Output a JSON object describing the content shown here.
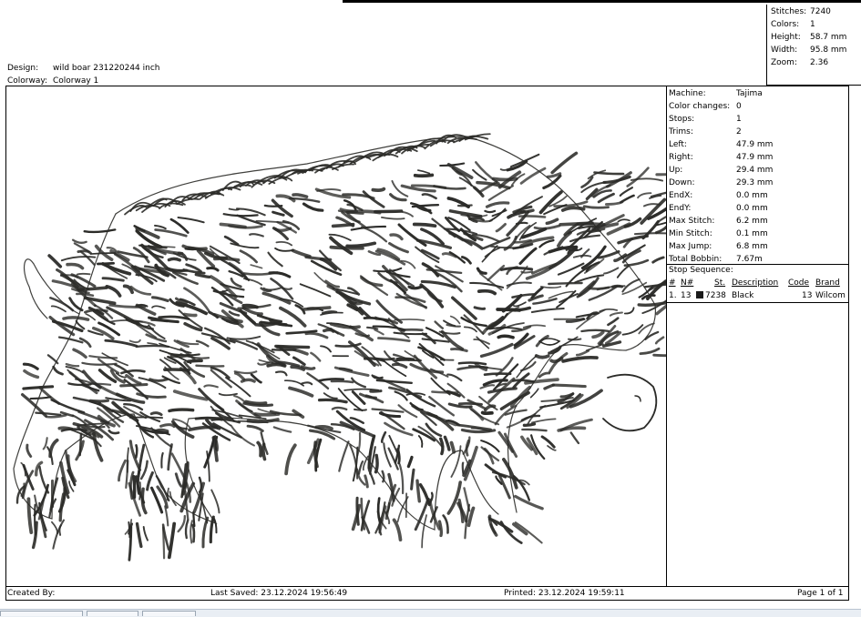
{
  "stats": {
    "stitches_label": "Stitches:",
    "stitches_value": "7240",
    "colors_label": "Colors:",
    "colors_value": "1",
    "height_label": "Height:",
    "height_value": "58.7 mm",
    "width_label": "Width:",
    "width_value": "95.8 mm",
    "zoom_label": "Zoom:",
    "zoom_value": "2.36"
  },
  "header": {
    "design_label": "Design:",
    "design_value": "wild boar 231220244 inch",
    "colorway_label": "Colorway:",
    "colorway_value": "Colorway 1"
  },
  "machine": {
    "rows": [
      {
        "label": "Machine:",
        "value": "Tajima"
      },
      {
        "label": "Color changes:",
        "value": "0"
      },
      {
        "label": "Stops:",
        "value": "1"
      },
      {
        "label": "Trims:",
        "value": "2"
      },
      {
        "label": "Left:",
        "value": "47.9 mm"
      },
      {
        "label": "Right:",
        "value": "47.9 mm"
      },
      {
        "label": "Up:",
        "value": "29.4 mm"
      },
      {
        "label": "Down:",
        "value": "29.3 mm"
      },
      {
        "label": "EndX:",
        "value": "0.0 mm"
      },
      {
        "label": "EndY:",
        "value": "0.0 mm"
      },
      {
        "label": "Max Stitch:",
        "value": "6.2 mm"
      },
      {
        "label": "Min Stitch:",
        "value": "0.1 mm"
      },
      {
        "label": "Max Jump:",
        "value": "6.8 mm"
      },
      {
        "label": "Total Bobbin:",
        "value": "7.67m"
      }
    ]
  },
  "stop_sequence": {
    "title": "Stop Sequence:",
    "headers": [
      "#",
      "N#",
      "St.",
      "Description",
      "Code",
      "Brand"
    ],
    "rows": [
      {
        "index": "1.",
        "needle": "13",
        "stitches": "7238",
        "description": "Black",
        "code": "13",
        "brand": "Wilcom",
        "color": "#1a1a1a"
      }
    ]
  },
  "footer": {
    "created_by": "Created By:",
    "last_saved": "Last Saved: 23.12.2024 19:56:49",
    "printed": "Printed: 23.12.2024 19:59:11",
    "page": "Page 1 of 1"
  },
  "colors": {
    "thread": "#2b2b28",
    "frame": "#000000"
  }
}
